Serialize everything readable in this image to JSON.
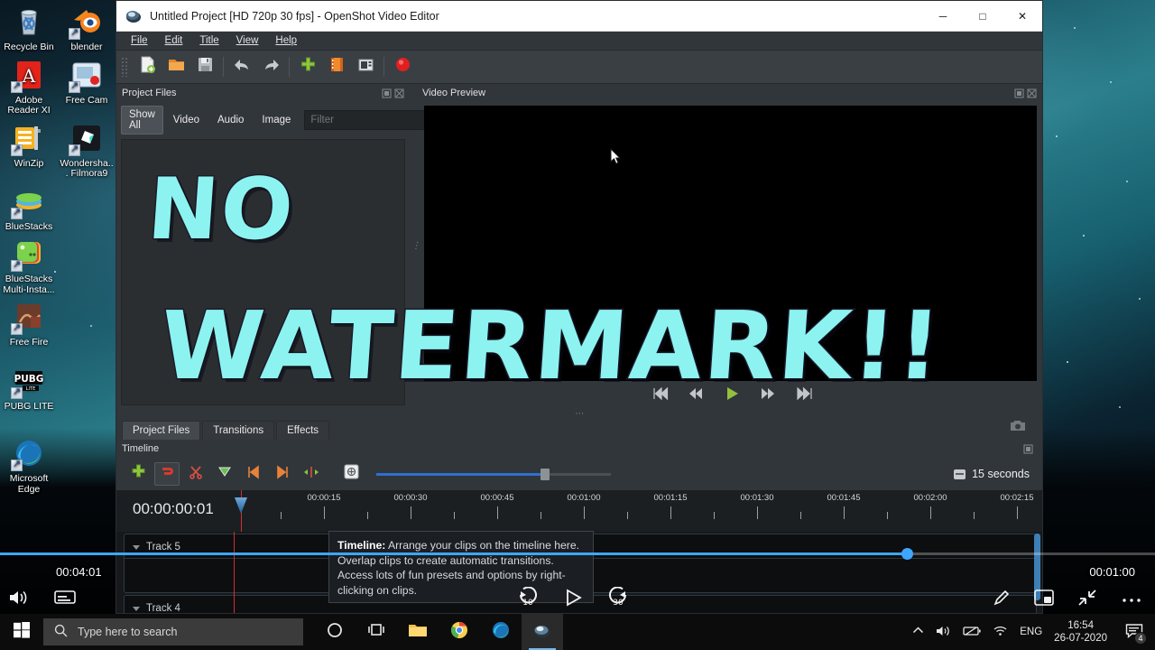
{
  "desktop": {
    "icons": [
      {
        "label": "Recycle Bin",
        "icon": "recycle-bin-icon"
      },
      {
        "label": "blender",
        "icon": "blender-icon"
      },
      {
        "label": "Adobe Reader XI",
        "icon": "adobe-reader-icon"
      },
      {
        "label": "Free Cam",
        "icon": "free-cam-icon"
      },
      {
        "label": "WinZip",
        "icon": "winzip-icon"
      },
      {
        "label": "Wondersha... Filmora9",
        "icon": "filmora-icon"
      },
      {
        "label": "BlueStacks",
        "icon": "bluestacks-icon"
      },
      {
        "label": "BlueStacks Multi-Insta...",
        "icon": "bluestacks-multi-icon"
      },
      {
        "label": "Free Fire",
        "icon": "free-fire-icon"
      },
      {
        "label": "PUBG LITE",
        "icon": "pubg-lite-icon"
      },
      {
        "label": "Microsoft Edge",
        "icon": "microsoft-edge-icon"
      }
    ]
  },
  "app": {
    "title": "Untitled Project [HD 720p 30 fps] - OpenShot Video Editor",
    "window_controls": {
      "minimize": "─",
      "maximize": "□",
      "close": "✕"
    },
    "menu": [
      "File",
      "Edit",
      "Title",
      "View",
      "Help"
    ],
    "toolbar_icons": [
      "new-project-icon",
      "open-project-icon",
      "save-project-icon",
      "undo-icon",
      "redo-icon",
      "import-files-icon",
      "choose-profile-icon",
      "fullscreen-icon",
      "export-video-icon"
    ],
    "project_files": {
      "panel_title": "Project Files",
      "filters": [
        "Show All",
        "Video",
        "Audio",
        "Image"
      ],
      "active_filter": "Show All",
      "search_placeholder": "Filter",
      "search_value": ""
    },
    "preview": {
      "panel_title": "Video Preview",
      "controls": [
        "jump-start-icon",
        "rewind-icon",
        "play-icon",
        "fast-forward-icon",
        "jump-end-icon"
      ],
      "capture_icon": "camera-icon"
    },
    "tabs": [
      {
        "label": "Project Files",
        "active": true
      },
      {
        "label": "Transitions",
        "active": false
      },
      {
        "label": "Effects",
        "active": false
      }
    ],
    "timeline": {
      "panel_title": "Timeline",
      "tools": [
        "add-track-icon",
        "snapping-icon",
        "razor-tool-icon",
        "add-marker-icon",
        "previous-marker-icon",
        "next-marker-icon",
        "center-playhead-icon"
      ],
      "zoom_icon": "zoom-fit-icon",
      "zoom_level_icon": "zoom-level-icon",
      "zoom_label": "15 seconds",
      "playhead_timecode": "00:00:00:01",
      "ruler_labels": [
        "00:00:15",
        "00:00:30",
        "00:00:45",
        "00:01:00",
        "00:01:15",
        "00:01:30",
        "00:01:45",
        "00:02:00",
        "00:02:15"
      ],
      "tracks": [
        {
          "label": "Track 5"
        },
        {
          "label": "Track 4"
        }
      ]
    }
  },
  "tooltip": {
    "title": "Timeline:",
    "body": " Arrange your clips on the timeline here. Overlap clips to create automatic transitions. Access lots of fun presets and options by right-clicking on clips."
  },
  "watermark": {
    "line1": "NO",
    "line2": "WATERMARK!!",
    "color": "#8df3f0"
  },
  "player": {
    "current_time": "00:04:01",
    "duration": "00:01:00",
    "progress_percent": 78.5,
    "accent_color": "#3ea6ff",
    "left_controls": [
      "replay-10-icon",
      "play-icon",
      "forward-30-icon"
    ],
    "right_controls": [
      "edit-pencil-icon",
      "picture-in-picture-icon",
      "exit-fullscreen-icon",
      "more-options-icon"
    ]
  },
  "taskbar": {
    "start_icon": "windows-start-icon",
    "search_icon": "search-icon",
    "search_placeholder": "Type here to search",
    "apps": [
      "cortana-icon",
      "task-view-icon",
      "file-explorer-icon",
      "chrome-icon",
      "edge-icon",
      "openshot-icon"
    ],
    "tray": {
      "chevron": "show-hidden-icons-icon",
      "volume": "volume-icon",
      "battery": "battery-icon",
      "network": "wifi-icon",
      "language": "ENG",
      "time": "16:54",
      "date": "26-07-2020",
      "notifications_count": "4"
    }
  }
}
